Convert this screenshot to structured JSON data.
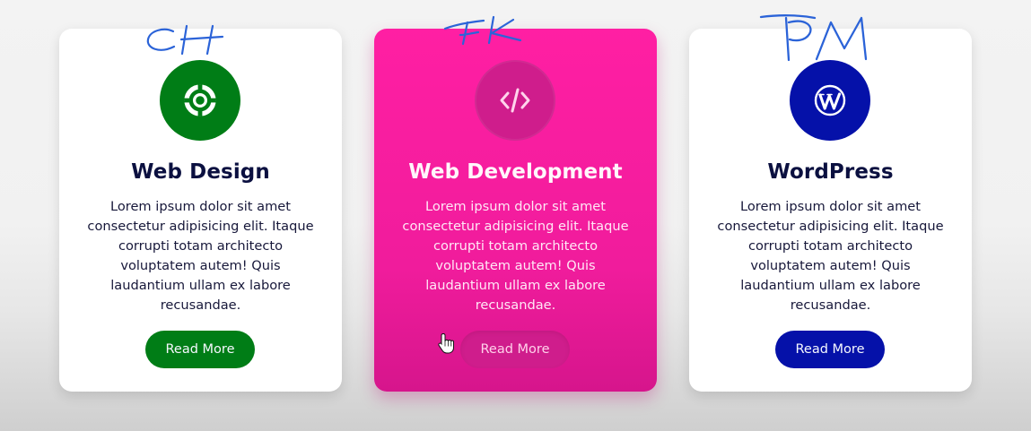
{
  "theme": {
    "page_background": "#f1f1f1",
    "card_background": "#ffffff",
    "active_card_color": "#ff1fa3",
    "heading_color": "#0b1040",
    "body_text_color": "#17183a"
  },
  "cards": [
    {
      "title": "Web Design",
      "description": "Lorem ipsum dolor sit amet consectetur adipisicing elit. Itaque corrupti totam architecto voluptatem autem! Quis laudantium ullam ex labore recusandae.",
      "button_label": "Read More",
      "icon": "lifebuoy-icon",
      "accent_color": "#007d16",
      "annotation_initials": "CH",
      "hovered": false
    },
    {
      "title": "Web Development",
      "description": "Lorem ipsum dolor sit amet consectetur adipisicing elit. Itaque corrupti totam architecto voluptatem autem! Quis laudantium ullam ex labore recusandae.",
      "button_label": "Read More",
      "icon": "code-icon",
      "accent_color": "#cf1d8c",
      "annotation_initials": "FK",
      "hovered": true
    },
    {
      "title": "WordPress",
      "description": "Lorem ipsum dolor sit amet consectetur adipisicing elit. Itaque corrupti totam architecto voluptatem autem! Quis laudantium ullam ex labore recusandae.",
      "button_label": "Read More",
      "icon": "wordpress-icon",
      "accent_color": "#0511a9",
      "annotation_initials": "PM",
      "hovered": false
    }
  ]
}
